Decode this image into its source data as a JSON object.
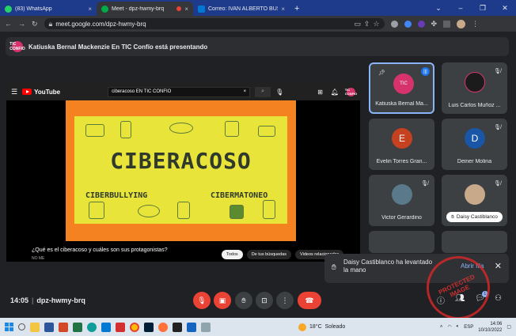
{
  "browser": {
    "tabs": [
      {
        "label": "(83) WhatsApp",
        "favicon_color": "#25d366",
        "active": false
      },
      {
        "label": "Meet - dpz-hwmy-brq",
        "favicon_color": "#00ac47",
        "active": true
      },
      {
        "label": "Correo: IVAN ALBERTO BUSTAM",
        "favicon_color": "#0078d4",
        "active": false
      }
    ],
    "new_tab": "+",
    "url": "meet.google.com/dpz-hwmy-brq"
  },
  "banner": {
    "badge_text": "TIC CONFIO",
    "text": "Katiuska Bernal Mackenzie En TIC Confío está presentando"
  },
  "youtube": {
    "logo": "YouTube",
    "search_query": "ciberacoso EN TIC CONFIO",
    "video_title": "¿Qué es el ciberacoso y cuáles son sus protagonistas?",
    "meta_text": "NO ME",
    "chips": [
      "Todos",
      "De tus búsquedas",
      "Videos relacionados"
    ],
    "thumbnail": {
      "title": "CIBERACOSO",
      "left_label": "CIBERBULLYING",
      "right_label": "CIBERMATONEO"
    }
  },
  "participants": [
    {
      "name": "Katiuska Bernal Ma...",
      "avatar_letter": "TIC",
      "avatar_color": "#d6336c",
      "selected": true,
      "speaking": true
    },
    {
      "name": "Luis Carlos Muñoz ...",
      "avatar_letter": "",
      "avatar_color": "#1b1b1b",
      "selected": false
    },
    {
      "name": "Evelin Torres Gran...",
      "avatar_letter": "E",
      "avatar_color": "#c5411f",
      "selected": false
    },
    {
      "name": "Deiner Molina",
      "avatar_letter": "D",
      "avatar_color": "#1a56a8",
      "selected": false
    },
    {
      "name": "Victor Gerardino",
      "avatar_letter": "",
      "avatar_color": "#5a7a8c",
      "selected": false
    },
    {
      "name": "Daisy Castiblanco",
      "avatar_letter": "",
      "avatar_color": "#c8a98a",
      "selected": false,
      "hand_raised": true
    }
  ],
  "toast": {
    "message": "Daisy Castiblanco ha levantado la mano",
    "action": "Abrir fila"
  },
  "meeting": {
    "time": "14:05",
    "code": "dpz-hwmy-brq",
    "chat_count": "1"
  },
  "watermark": {
    "text": "PROTECTED IMAGE"
  },
  "taskbar": {
    "weather_temp": "18°C",
    "weather_desc": "Soleado",
    "language": "ESP",
    "clock_time": "14:06",
    "clock_date": "10/10/2022"
  }
}
